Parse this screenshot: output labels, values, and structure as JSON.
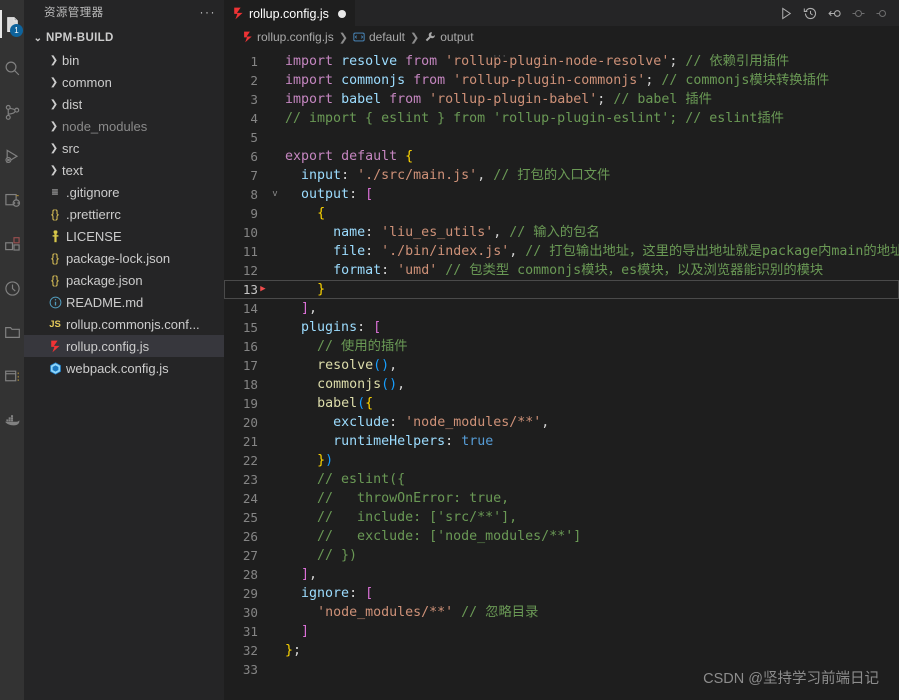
{
  "activity_bar": {
    "items": [
      {
        "name": "explorer-icon",
        "badge": "1",
        "active": true
      },
      {
        "name": "search-icon",
        "badge": "",
        "active": false
      },
      {
        "name": "source-control-icon",
        "badge": "",
        "active": false
      },
      {
        "name": "run-and-debug-icon",
        "badge": "",
        "active": false
      },
      {
        "name": "extensions-icon",
        "badge": "",
        "active": false
      },
      {
        "name": "blocks-icon",
        "badge": "",
        "active": false
      },
      {
        "name": "clock-circle-icon",
        "badge": "",
        "active": false
      },
      {
        "name": "folder-icon",
        "badge": "",
        "active": false
      },
      {
        "name": "window-icon",
        "badge": "",
        "active": false
      },
      {
        "name": "docker-icon",
        "badge": "",
        "active": false
      }
    ]
  },
  "sidebar": {
    "title": "资源管理器",
    "more_actions": "···",
    "root": "NPM-BUILD",
    "items": [
      {
        "label": "bin",
        "type": "folder",
        "icon": "chevron-right-icon",
        "dim": false,
        "selected": false
      },
      {
        "label": "common",
        "type": "folder",
        "icon": "chevron-right-icon",
        "dim": false,
        "selected": false
      },
      {
        "label": "dist",
        "type": "folder",
        "icon": "chevron-right-icon",
        "dim": false,
        "selected": false
      },
      {
        "label": "node_modules",
        "type": "folder",
        "icon": "chevron-right-icon",
        "dim": true,
        "selected": false
      },
      {
        "label": "src",
        "type": "folder",
        "icon": "chevron-right-icon",
        "dim": false,
        "selected": false
      },
      {
        "label": "text",
        "type": "folder",
        "icon": "chevron-right-icon",
        "dim": false,
        "selected": false
      },
      {
        "label": ".gitignore",
        "type": "file",
        "icon": "gitignore-icon",
        "dim": false,
        "selected": false
      },
      {
        "label": ".prettierrc",
        "type": "file",
        "icon": "json-icon",
        "dim": false,
        "selected": false
      },
      {
        "label": "LICENSE",
        "type": "file",
        "icon": "license-icon",
        "dim": false,
        "selected": false
      },
      {
        "label": "package-lock.json",
        "type": "file",
        "icon": "json-icon",
        "dim": false,
        "selected": false
      },
      {
        "label": "package.json",
        "type": "file",
        "icon": "json-icon",
        "dim": false,
        "selected": false
      },
      {
        "label": "README.md",
        "type": "file",
        "icon": "info-icon",
        "dim": false,
        "selected": false
      },
      {
        "label": "rollup.commonjs.conf...",
        "type": "file",
        "icon": "js-icon",
        "dim": false,
        "selected": false
      },
      {
        "label": "rollup.config.js",
        "type": "file",
        "icon": "rollup-icon",
        "dim": false,
        "selected": true
      },
      {
        "label": "webpack.config.js",
        "type": "file",
        "icon": "webpack-icon",
        "dim": false,
        "selected": false
      }
    ]
  },
  "editor": {
    "tab": {
      "label": "rollup.config.js",
      "icon": "rollup-icon",
      "dirty": true
    },
    "tab_actions": [
      {
        "name": "run-file-icon",
        "title": "Run"
      },
      {
        "name": "history-icon",
        "title": "Timeline"
      },
      {
        "name": "split-left-icon",
        "title": "Open Changes"
      },
      {
        "name": "split-editor-icon",
        "title": "Split Editor"
      },
      {
        "name": "more-actions-icon",
        "title": "More Actions"
      }
    ],
    "breadcrumb": [
      {
        "label": "rollup.config.js",
        "icon": "rollup-icon"
      },
      {
        "label": "default",
        "icon": "module-icon"
      },
      {
        "label": "output",
        "icon": "property-wrench-icon"
      }
    ],
    "minimap_dots": "···",
    "current_line": 13,
    "lines": [
      {
        "n": 1,
        "fold": "",
        "marker": "",
        "code": "import resolve from 'rollup-plugin-node-resolve'; // 依赖引用插件"
      },
      {
        "n": 2,
        "fold": "",
        "marker": "",
        "code": "import commonjs from 'rollup-plugin-commonjs'; // commonjs模块转换插件"
      },
      {
        "n": 3,
        "fold": "",
        "marker": "",
        "code": "import babel from 'rollup-plugin-babel'; // babel 插件"
      },
      {
        "n": 4,
        "fold": "",
        "marker": "",
        "code": "// import { eslint } from 'rollup-plugin-eslint'; // eslint插件"
      },
      {
        "n": 5,
        "fold": "",
        "marker": "",
        "code": ""
      },
      {
        "n": 6,
        "fold": "",
        "marker": "",
        "code": "export default {"
      },
      {
        "n": 7,
        "fold": "",
        "marker": "",
        "code": "  input: './src/main.js', // 打包的入口文件"
      },
      {
        "n": 8,
        "fold": "v",
        "marker": "",
        "code": "  output: ["
      },
      {
        "n": 9,
        "fold": "",
        "marker": "",
        "code": "    {"
      },
      {
        "n": 10,
        "fold": "",
        "marker": "",
        "code": "      name: 'liu_es_utils', // 输入的包名"
      },
      {
        "n": 11,
        "fold": "",
        "marker": "",
        "code": "      file: './bin/index.js', // 打包输出地址，这里的导出地址就是package内main的地址"
      },
      {
        "n": 12,
        "fold": "",
        "marker": "",
        "code": "      format: 'umd' // 包类型 commonjs模块，es模块，以及浏览器能识别的模块"
      },
      {
        "n": 13,
        "fold": "",
        "marker": "▶",
        "code": "    }"
      },
      {
        "n": 14,
        "fold": "",
        "marker": "",
        "code": "  ],"
      },
      {
        "n": 15,
        "fold": "",
        "marker": "",
        "code": "  plugins: ["
      },
      {
        "n": 16,
        "fold": "",
        "marker": "",
        "code": "    // 使用的插件"
      },
      {
        "n": 17,
        "fold": "",
        "marker": "",
        "code": "    resolve(),"
      },
      {
        "n": 18,
        "fold": "",
        "marker": "",
        "code": "    commonjs(),"
      },
      {
        "n": 19,
        "fold": "",
        "marker": "",
        "code": "    babel({"
      },
      {
        "n": 20,
        "fold": "",
        "marker": "",
        "code": "      exclude: 'node_modules/**',"
      },
      {
        "n": 21,
        "fold": "",
        "marker": "",
        "code": "      runtimeHelpers: true"
      },
      {
        "n": 22,
        "fold": "",
        "marker": "",
        "code": "    })"
      },
      {
        "n": 23,
        "fold": "",
        "marker": "",
        "code": "    // eslint({"
      },
      {
        "n": 24,
        "fold": "",
        "marker": "",
        "code": "    //   throwOnError: true,"
      },
      {
        "n": 25,
        "fold": "",
        "marker": "",
        "code": "    //   include: ['src/**'],"
      },
      {
        "n": 26,
        "fold": "",
        "marker": "",
        "code": "    //   exclude: ['node_modules/**']"
      },
      {
        "n": 27,
        "fold": "",
        "marker": "",
        "code": "    // })"
      },
      {
        "n": 28,
        "fold": "",
        "marker": "",
        "code": "  ],"
      },
      {
        "n": 29,
        "fold": "",
        "marker": "",
        "code": "  ignore: ["
      },
      {
        "n": 30,
        "fold": "",
        "marker": "",
        "code": "    'node_modules/**' // 忽略目录"
      },
      {
        "n": 31,
        "fold": "",
        "marker": "",
        "code": "  ]"
      },
      {
        "n": 32,
        "fold": "",
        "marker": "",
        "code": "};"
      },
      {
        "n": 33,
        "fold": "",
        "marker": "",
        "code": ""
      }
    ]
  },
  "watermark": "CSDN @坚持学习前端日记",
  "colors": {
    "editor_bg": "#1e1e1e",
    "sidebar_bg": "#252526",
    "activitybar_bg": "#333333",
    "selection_bg": "#37373d",
    "badge_bg": "#0e639c",
    "comment": "#6a9955",
    "string": "#ce9178",
    "keyword": "#c586c0",
    "property": "#9cdcfe",
    "marker_red": "#f14c4c"
  }
}
